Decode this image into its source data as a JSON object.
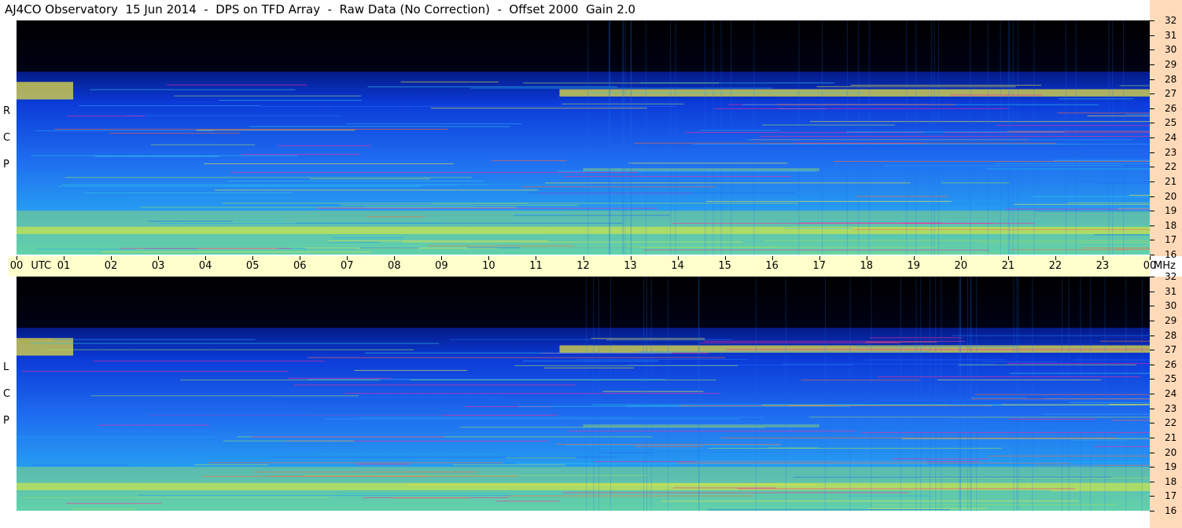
{
  "title": "AJ4CO Observatory  15 Jun 2014  -  DPS on TFD Array  -  Raw Data (No Correction)  -  Offset 2000  Gain 2.0",
  "chart_data": {
    "type": "heatmap",
    "panels": [
      {
        "name": "RCP",
        "side_label": [
          "R",
          "C",
          "P"
        ]
      },
      {
        "name": "LCP",
        "side_label": [
          "L",
          "C",
          "P"
        ]
      }
    ],
    "x_ticks": [
      "00",
      "01",
      "02",
      "03",
      "04",
      "05",
      "06",
      "07",
      "08",
      "09",
      "10",
      "11",
      "12",
      "13",
      "14",
      "15",
      "16",
      "17",
      "18",
      "19",
      "20",
      "21",
      "22",
      "23",
      "00"
    ],
    "x_unit": "UTC",
    "x_range_hours": [
      0,
      24
    ],
    "y_ticks": [
      16,
      17,
      18,
      19,
      20,
      21,
      22,
      23,
      24,
      25,
      26,
      27,
      28,
      29,
      30,
      31,
      32
    ],
    "y_unit": "MHz",
    "y_range_mhz": [
      16,
      32
    ],
    "colormap": [
      "#000000",
      "#000a5c",
      "#0b3ad8",
      "#1f6ef0",
      "#27a4f0",
      "#30c6e8",
      "#9fe060",
      "#f2e83a",
      "#ff6a3a",
      "#ff2a9a"
    ],
    "intensity_features": [
      {
        "feature": "strong band",
        "mhz": [
          26.8,
          27.3
        ],
        "hours": [
          11.5,
          24
        ],
        "level": "high"
      },
      {
        "feature": "strong band",
        "mhz": [
          26.6,
          27.8
        ],
        "hours": [
          0,
          1.2
        ],
        "level": "high"
      },
      {
        "feature": "strong band",
        "mhz": [
          17.4,
          17.9
        ],
        "hours": [
          0,
          24
        ],
        "level": "high"
      },
      {
        "feature": "band",
        "mhz": [
          21.7,
          21.9
        ],
        "hours": [
          12,
          17
        ],
        "level": "medium"
      },
      {
        "feature": "low-band noise",
        "mhz": [
          16,
          19
        ],
        "hours": [
          0,
          24
        ],
        "level": "medium"
      },
      {
        "feature": "background",
        "mhz": [
          16,
          26.5
        ],
        "hours": [
          0,
          24
        ],
        "level": "low"
      },
      {
        "feature": "absorption (dark)",
        "mhz": [
          28.5,
          32
        ],
        "hours": [
          0,
          24
        ],
        "level": "none"
      }
    ]
  }
}
